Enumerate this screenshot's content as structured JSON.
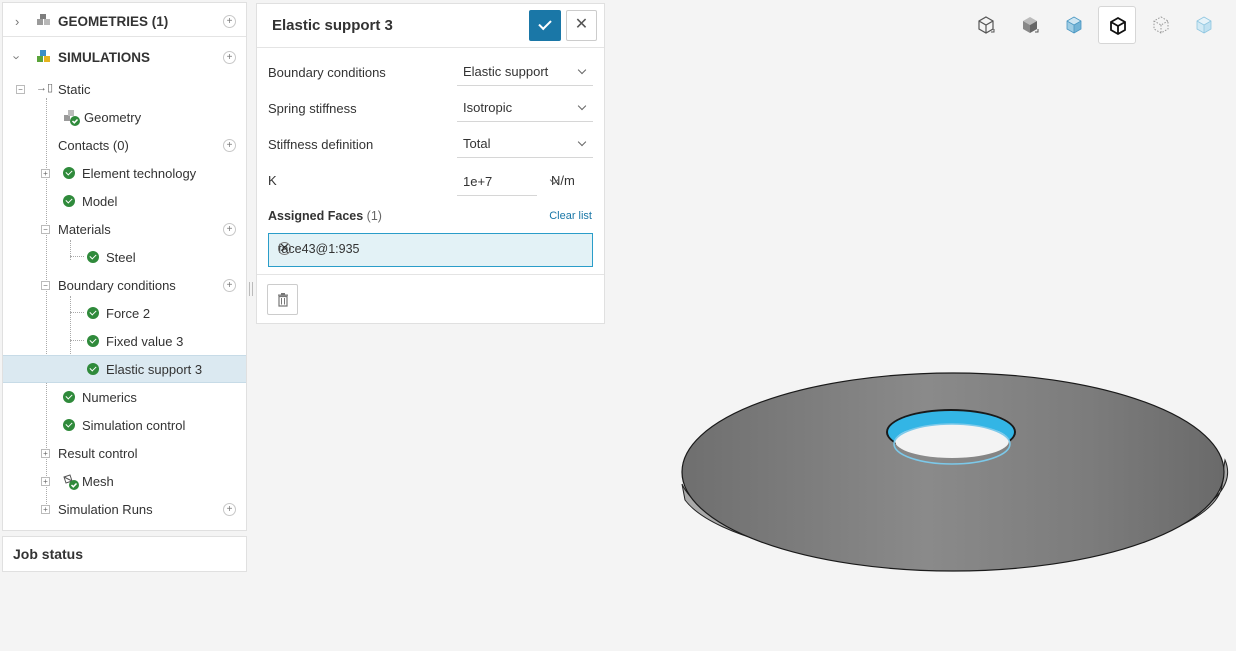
{
  "tree": {
    "geometries_label": "GEOMETRIES (1)",
    "simulations_label": "SIMULATIONS",
    "items": [
      {
        "label": "Static"
      },
      {
        "label": "Geometry"
      },
      {
        "label": "Contacts (0)"
      },
      {
        "label": "Element technology"
      },
      {
        "label": "Model"
      },
      {
        "label": "Materials"
      },
      {
        "label": "Steel"
      },
      {
        "label": "Boundary conditions"
      },
      {
        "label": "Force 2"
      },
      {
        "label": "Fixed value 3"
      },
      {
        "label": "Elastic support 3"
      },
      {
        "label": "Numerics"
      },
      {
        "label": "Simulation control"
      },
      {
        "label": "Result control"
      },
      {
        "label": "Mesh"
      },
      {
        "label": "Simulation Runs"
      }
    ]
  },
  "job_status": {
    "title": "Job status"
  },
  "panel": {
    "title": "Elastic support 3",
    "fields": [
      {
        "label": "Boundary conditions",
        "value": "Elastic support"
      },
      {
        "label": "Spring stiffness",
        "value": "Isotropic"
      },
      {
        "label": "Stiffness definition",
        "value": "Total"
      }
    ],
    "k": {
      "label": "K",
      "value": "1e+7",
      "unit": "N/m"
    },
    "assigned": {
      "title": "Assigned Faces",
      "count": "(1)",
      "clear_label": "Clear list",
      "face": "face43@1:935"
    }
  },
  "colors": {
    "accent": "#1a77a7",
    "check": "#2f8a3b",
    "selection": "#33b5e5"
  },
  "toolbar": {
    "icons": [
      "iso-wire-cube-icon",
      "iso-solid-cube-icon",
      "iso-transparent-cube-icon",
      "iso-edge-cube-icon",
      "points-cube-icon",
      "light-cube-icon"
    ],
    "active_index": 3
  }
}
